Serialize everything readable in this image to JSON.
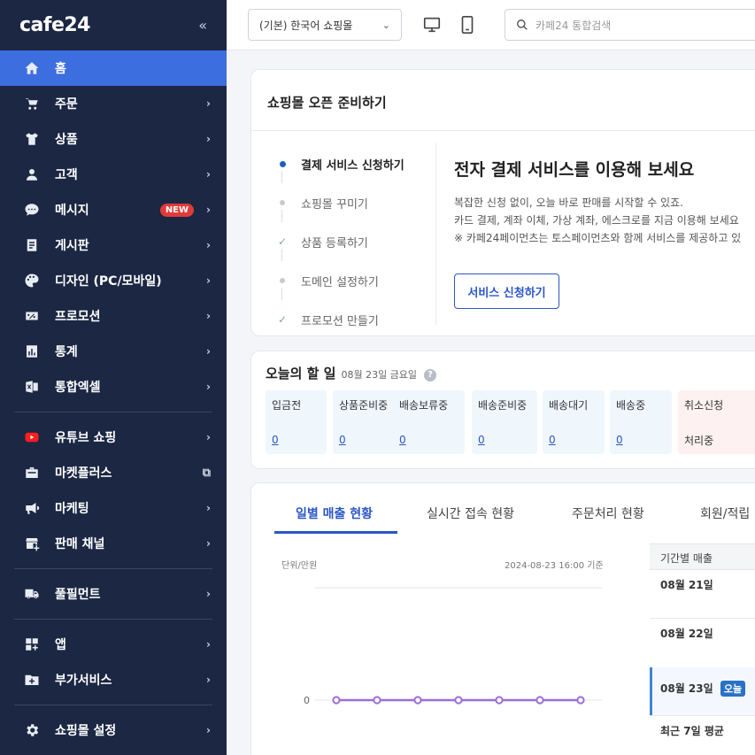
{
  "sidebar": {
    "logo": "cafe24",
    "collapse": "«",
    "items": [
      {
        "label": "홈",
        "icon": "home-icon"
      },
      {
        "label": "주문",
        "icon": "cart-icon"
      },
      {
        "label": "상품",
        "icon": "shirt-icon"
      },
      {
        "label": "고객",
        "icon": "user-icon"
      },
      {
        "label": "메시지",
        "icon": "chat-icon",
        "badge": "NEW"
      },
      {
        "label": "게시판",
        "icon": "board-icon"
      },
      {
        "label": "디자인 (PC/모바일)",
        "icon": "palette-icon"
      },
      {
        "label": "프로모션",
        "icon": "percent-icon"
      },
      {
        "label": "통계",
        "icon": "chart-icon"
      },
      {
        "label": "통합엑셀",
        "icon": "excel-icon"
      },
      {
        "label": "유튜브 쇼핑",
        "icon": "youtube-icon"
      },
      {
        "label": "마켓플러스",
        "icon": "market-icon"
      },
      {
        "label": "마케팅",
        "icon": "megaphone-icon"
      },
      {
        "label": "판매 채널",
        "icon": "store-icon"
      },
      {
        "label": "풀필먼트",
        "icon": "truck-icon"
      },
      {
        "label": "앱",
        "icon": "apps-icon"
      },
      {
        "label": "부가서비스",
        "icon": "folder-plus-icon"
      },
      {
        "label": "쇼핑몰 설정",
        "icon": "gear-icon"
      }
    ]
  },
  "topbar": {
    "shop_select": "(기본) 한국어 쇼핑몰",
    "search_placeholder": "카페24 통합검색"
  },
  "onboarding": {
    "title": "쇼핑몰 오픈 준비하기",
    "steps": [
      {
        "label": "결제 서비스 신청하기",
        "state": "active"
      },
      {
        "label": "쇼핑몰 꾸미기",
        "state": "pending"
      },
      {
        "label": "상품 등록하기",
        "state": "done"
      },
      {
        "label": "도메인 설정하기",
        "state": "pending"
      },
      {
        "label": "프로모션 만들기",
        "state": "done"
      }
    ],
    "promo_title": "전자 결제 서비스를 이용해 보세요",
    "promo_line1": "복잡한 신청 없이, 오늘 바로 판매를 시작할 수 있죠.",
    "promo_line2": "카드 결제, 계좌 이체, 가상 계좌, 에스크로를 지금 이용해 보세요",
    "promo_line3": "※ 카페24페이먼츠는 토스페이먼츠와 함께 서비스를 제공하고 있",
    "promo_button": "서비스 신청하기"
  },
  "todo": {
    "title": "오늘의 할 일",
    "date": "08월 23일 금요일",
    "help": "?",
    "tiles": [
      {
        "label": "입금전",
        "count": "0"
      },
      {
        "label": "상품준비중",
        "count": "0"
      },
      {
        "label": "배송보류중",
        "count": "0"
      },
      {
        "label": "배송준비중",
        "count": "0"
      },
      {
        "label": "배송대기",
        "count": "0"
      },
      {
        "label": "배송중",
        "count": "0"
      },
      {
        "label": "취소신청",
        "sub": "처리중"
      }
    ]
  },
  "sales": {
    "tabs": [
      "일별 매출 현황",
      "실시간 접속 현황",
      "주문처리 현황",
      "회원/적립"
    ],
    "unit": "단위/만원",
    "timestamp": "2024-08-23 16:00 기준",
    "side_header": "기간별 매출",
    "rows": [
      "08월 21일",
      "08월 22일",
      "08월 23일",
      "최근 7일 평균"
    ],
    "today_badge": "오늘",
    "colors": {
      "line": "#9b6fd6",
      "accent": "#2a56c6"
    }
  },
  "chart_data": {
    "type": "line",
    "y_tick_labels": [
      "0"
    ],
    "series": [
      {
        "values": [
          0,
          0,
          0,
          0,
          0,
          0,
          0
        ]
      }
    ]
  }
}
